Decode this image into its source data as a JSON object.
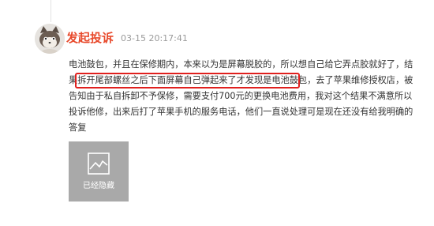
{
  "post": {
    "username": "发起投诉",
    "timestamp": "03-15 20:17:41",
    "content_lines": [
      "电池鼓包，并且在保修期内，本来以为是屏幕脱胶的，所以想自己给它弄点胶就好了，结",
      "果拆开尾部螺丝之后下面屏幕自己弹起来了才发现是电池鼓包，去了苹果维修授权店，被",
      "告知由于私自拆卸不予保修，需要支付700元的更换电池费用，我对这个结果不满意所以",
      "投诉他修，出来后打了苹果手机的服务电话，他们一直说处理可是现在还没有给我明确的",
      "答复"
    ],
    "hidden_image_label": "已经隐藏"
  },
  "colors": {
    "username": "#e84a2c",
    "highlight_border": "#e0201e",
    "hidden_image_bg": "#a9a9a9"
  },
  "icons": {
    "avatar": "cat-avatar-icon",
    "hidden_image": "image-placeholder-icon"
  }
}
